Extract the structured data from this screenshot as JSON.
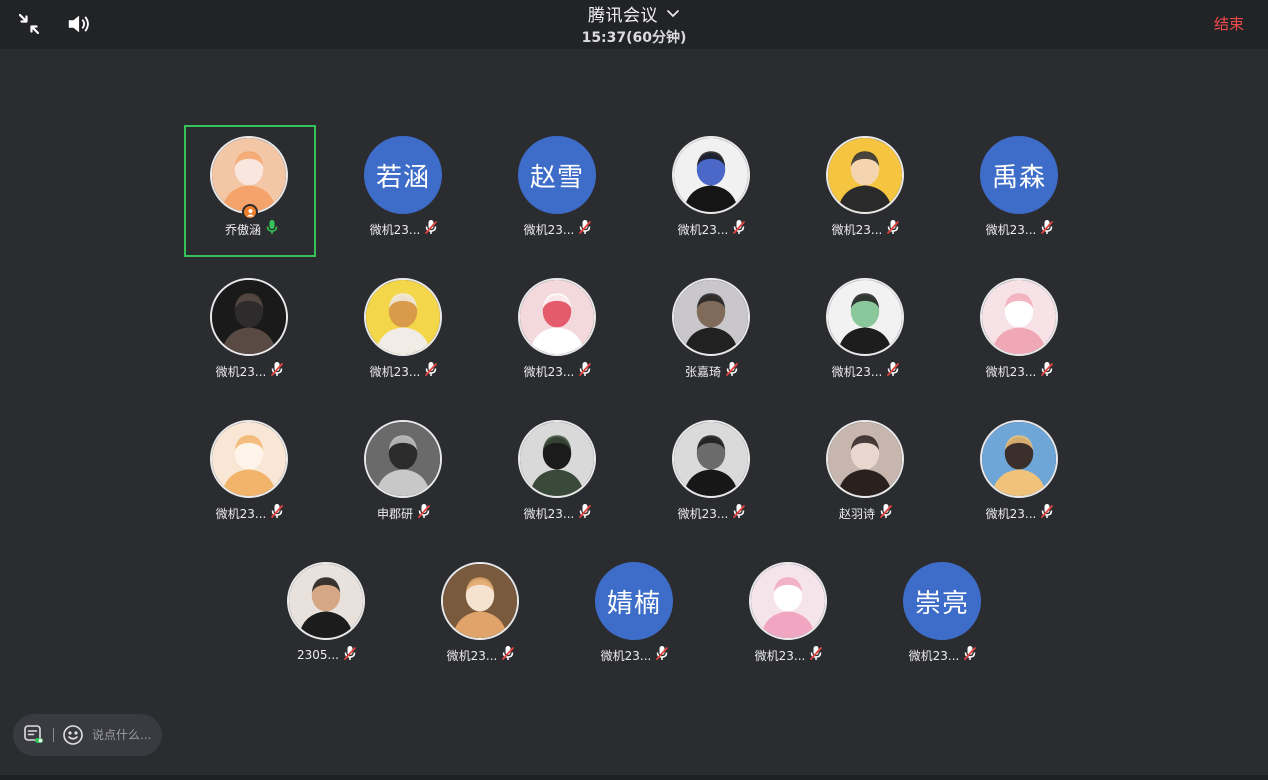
{
  "header": {
    "title": "腾讯会议",
    "timer": "15:37(60分钟)",
    "end_label": "结束"
  },
  "chat": {
    "placeholder": "说点什么..."
  },
  "colors": {
    "accent_green": "#35c257",
    "end_red": "#ef4b4b",
    "text_avatar_blue": "#3e6dc9"
  },
  "participants": [
    {
      "name": "乔傲涵",
      "avatar_text": "",
      "avatar": "cartoon-girl-photo",
      "mic": "on",
      "active": true,
      "host": true
    },
    {
      "name": "微机23...",
      "avatar_text": "若涵",
      "mic": "off"
    },
    {
      "name": "微机23...",
      "avatar_text": "赵雪",
      "mic": "off"
    },
    {
      "name": "微机23...",
      "avatar_text": "",
      "avatar": "tshirt-photo",
      "mic": "off"
    },
    {
      "name": "微机23...",
      "avatar_text": "",
      "avatar": "cartoon-kid-photo",
      "mic": "off"
    },
    {
      "name": "微机23...",
      "avatar_text": "禹森",
      "mic": "off"
    },
    {
      "name": "微机23...",
      "avatar_text": "",
      "avatar": "dark-portrait-photo",
      "mic": "off"
    },
    {
      "name": "微机23...",
      "avatar_text": "",
      "avatar": "yellow-dog-photo",
      "mic": "off"
    },
    {
      "name": "微机23...",
      "avatar_text": "",
      "avatar": "plush-bow-photo",
      "mic": "off"
    },
    {
      "name": "张嘉琦",
      "avatar_text": "",
      "avatar": "girl-jacket-photo",
      "mic": "off"
    },
    {
      "name": "微机23...",
      "avatar_text": "",
      "avatar": "anime-sketch-photo",
      "mic": "off"
    },
    {
      "name": "微机23...",
      "avatar_text": "",
      "avatar": "pink-cartoon-photo",
      "mic": "off"
    },
    {
      "name": "微机23...",
      "avatar_text": "",
      "avatar": "anime-smile-photo",
      "mic": "off"
    },
    {
      "name": "申郡研",
      "avatar_text": "",
      "avatar": "scarf-portrait-photo",
      "mic": "off"
    },
    {
      "name": "微机23...",
      "avatar_text": "",
      "avatar": "girl-indoor-photo",
      "mic": "off"
    },
    {
      "name": "微机23...",
      "avatar_text": "",
      "avatar": "curly-hair-photo",
      "mic": "off"
    },
    {
      "name": "赵羽诗",
      "avatar_text": "",
      "avatar": "girl-selfie-photo",
      "mic": "off"
    },
    {
      "name": "微机23...",
      "avatar_text": "",
      "avatar": "sunset-photo",
      "mic": "off"
    },
    {
      "name": "2305...",
      "avatar_text": "",
      "avatar": "boy-portrait-photo",
      "mic": "off"
    },
    {
      "name": "微机23...",
      "avatar_text": "",
      "avatar": "shiba-photo",
      "mic": "off"
    },
    {
      "name": "微机23...",
      "avatar_text": "婧楠",
      "mic": "off"
    },
    {
      "name": "微机23...",
      "avatar_text": "",
      "avatar": "pink-anime-photo",
      "mic": "off"
    },
    {
      "name": "微机23...",
      "avatar_text": "崇亮",
      "mic": "off"
    }
  ]
}
